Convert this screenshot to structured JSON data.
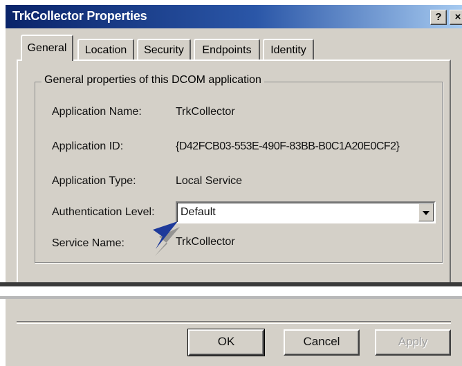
{
  "window": {
    "title": "TrkCollector Properties",
    "help_button": "?",
    "close_button": "×"
  },
  "tabs": [
    {
      "label": "General",
      "active": true
    },
    {
      "label": "Location",
      "active": false
    },
    {
      "label": "Security",
      "active": false
    },
    {
      "label": "Endpoints",
      "active": false
    },
    {
      "label": "Identity",
      "active": false
    }
  ],
  "general": {
    "group_title": "General properties of this DCOM application",
    "rows": [
      {
        "label": "Application Name:",
        "value": "TrkCollector"
      },
      {
        "label": "Application ID:",
        "value": "{D42FCB03-553E-490F-83BB-B0C1A20E0CF2}"
      },
      {
        "label": "Application Type:",
        "value": "Local Service"
      },
      {
        "label": "Authentication Level:",
        "value": "Default"
      },
      {
        "label": "Service Name:",
        "value": "TrkCollector"
      }
    ]
  },
  "buttons": {
    "ok": "OK",
    "cancel": "Cancel",
    "apply": "Apply"
  },
  "colors": {
    "title_bar_start": "#0a246a",
    "title_bar_end": "#a6caf0",
    "dialog_face": "#d4d0c8",
    "pointer_arrow": "#1e3a9a"
  },
  "icons": {
    "pointer": "pointer-arrow-icon",
    "dropdown": "dropdown-arrow-icon"
  }
}
